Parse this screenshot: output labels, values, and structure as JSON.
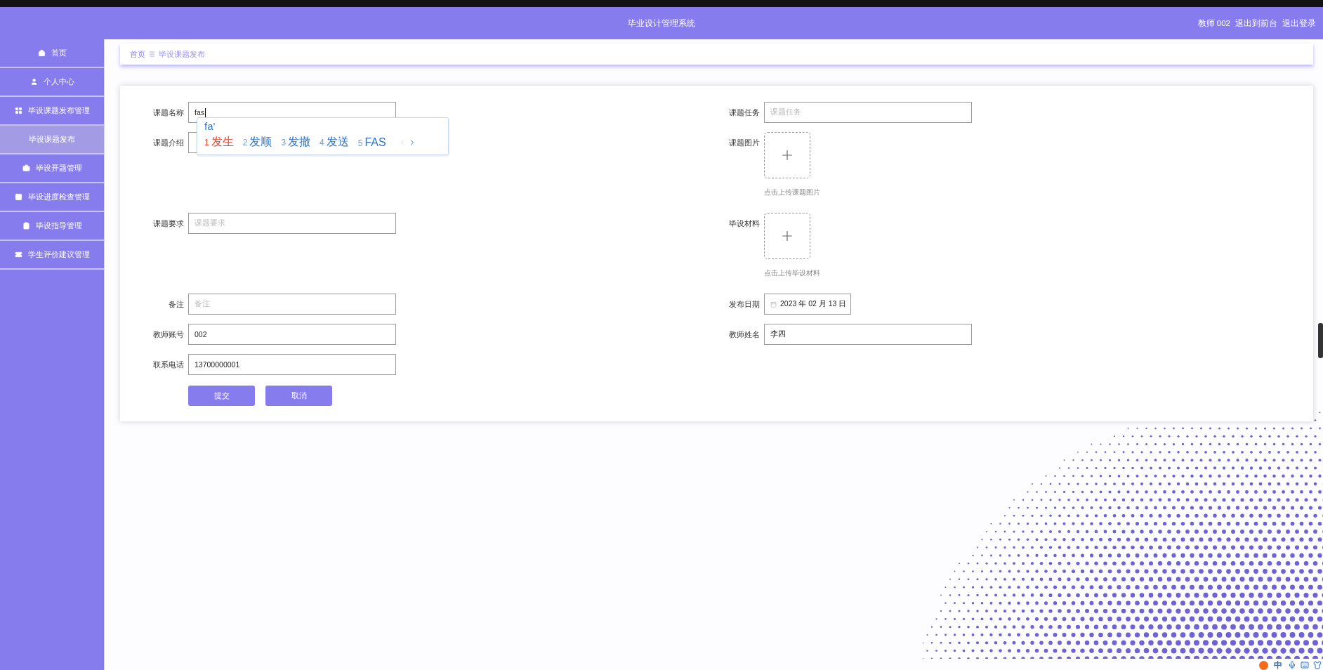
{
  "topbar": {
    "title": "毕业设计管理系统",
    "user": "教师 002",
    "links": [
      "退出到前台",
      "退出登录"
    ]
  },
  "sidebar": {
    "items": [
      {
        "label": "首页",
        "selected": false
      },
      {
        "label": "个人中心",
        "selected": false
      },
      {
        "label": "毕设课题发布管理",
        "selected": false,
        "expanded": true,
        "children": [
          {
            "label": "毕设课题发布",
            "selected": true
          }
        ]
      },
      {
        "label": "毕设开题管理",
        "selected": false
      },
      {
        "label": "毕设进度检查管理",
        "selected": false
      },
      {
        "label": "毕设指导管理",
        "selected": false
      },
      {
        "label": "学生评价建议管理",
        "selected": false
      }
    ]
  },
  "breadcrumb": [
    "首页",
    "毕设课题发布"
  ],
  "form": {
    "rows": [
      {
        "left": {
          "kind": "text",
          "label": "课题名称",
          "value": "fas",
          "focused": true
        },
        "right": {
          "kind": "text",
          "label": "课题任务",
          "placeholder": "课题任务",
          "focused": false
        }
      },
      {
        "left": {
          "kind": "text",
          "label": "课题介绍",
          "focused": false
        },
        "right": {
          "kind": "upload",
          "label": "课题图片",
          "hint": "点击上传课题图片"
        }
      },
      {
        "left": {
          "kind": "text",
          "label": "课题要求",
          "placeholder": "课题要求",
          "focused": false
        },
        "right": {
          "kind": "upload",
          "label": "毕设材料",
          "hint": "点击上传毕设材料"
        }
      },
      {
        "left": {
          "kind": "text",
          "label": "备注",
          "placeholder": "备注",
          "focused": false
        },
        "right": {
          "kind": "date",
          "label": "发布日期",
          "value": "2023 年 02 月 13 日"
        }
      },
      {
        "left": {
          "kind": "text",
          "label": "教师账号",
          "value": "002",
          "focused": false
        },
        "right": {
          "kind": "text",
          "label": "教师姓名",
          "value": "李四",
          "focused": false
        }
      },
      {
        "left": {
          "kind": "text",
          "label": "联系电话",
          "value": "13700000001",
          "focused": false
        }
      }
    ],
    "buttons": [
      "提交",
      "取消"
    ]
  },
  "ime_popup": {
    "composition": "fa'",
    "candidates": [
      {
        "index": "1",
        "text": "发生",
        "selected": true
      },
      {
        "index": "2",
        "text": "发顺",
        "selected": false
      },
      {
        "index": "3",
        "text": "发撤",
        "selected": false
      },
      {
        "index": "4",
        "text": "发送",
        "selected": false
      },
      {
        "index": "5",
        "text": "FAS",
        "selected": false
      }
    ],
    "prev_disabled": true,
    "next_disabled": false
  },
  "ime_status": {
    "mode": "中"
  }
}
